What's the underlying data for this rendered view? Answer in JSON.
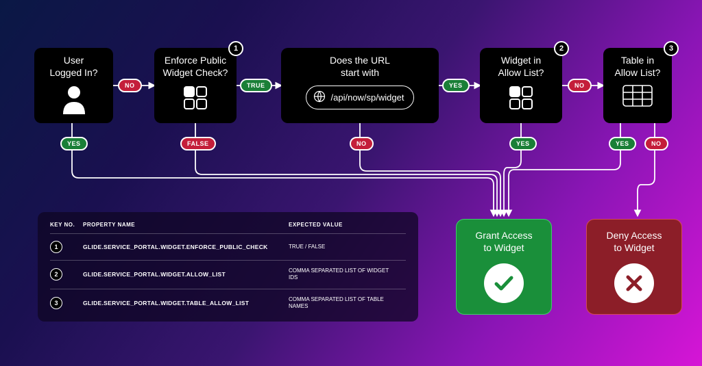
{
  "nodes": {
    "n1": {
      "line1": "User",
      "line2": "Logged In?"
    },
    "n2": {
      "line1": "Enforce Public",
      "line2": "Widget Check?"
    },
    "n3": {
      "line1": "Does the URL",
      "line2": "start with",
      "url": "/api/now/sp/widget"
    },
    "n4": {
      "line1": "Widget in",
      "line2": "Allow List?"
    },
    "n5": {
      "line1": "Table in",
      "line2": "Allow List?"
    }
  },
  "badges": {
    "b2": "1",
    "b4": "2",
    "b5": "3"
  },
  "pills": {
    "p1_right": "NO",
    "p2_right": "TRUE",
    "p3_right": "YES",
    "p4_right": "NO",
    "p1_down": "YES",
    "p2_down": "FALSE",
    "p3_down": "NO",
    "p4_down": "YES",
    "p5_down_yes": "YES",
    "p5_down_no": "NO"
  },
  "results": {
    "grant": {
      "line1": "Grant Access",
      "line2": "to Widget"
    },
    "deny": {
      "line1": "Deny Access",
      "line2": "to Widget"
    }
  },
  "legend": {
    "head": {
      "c1": "KEY NO.",
      "c2": "PROPERTY NAME",
      "c3": "EXPECTED VALUE"
    },
    "rows": [
      {
        "num": "1",
        "name": "GLIDE.SERVICE_PORTAL.WIDGET.ENFORCE_PUBLIC_CHECK",
        "val": "TRUE / FALSE"
      },
      {
        "num": "2",
        "name": "GLIDE.SERVICE_PORTAL.WIDGET.ALLOW_LIST",
        "val": "COMMA SEPARATED LIST OF WIDGET IDS"
      },
      {
        "num": "3",
        "name": "GLIDE.SERVICE_PORTAL.WIDGET.TABLE_ALLOW_LIST",
        "val": "COMMA SEPARATED LIST OF TABLE NAMES"
      }
    ]
  }
}
